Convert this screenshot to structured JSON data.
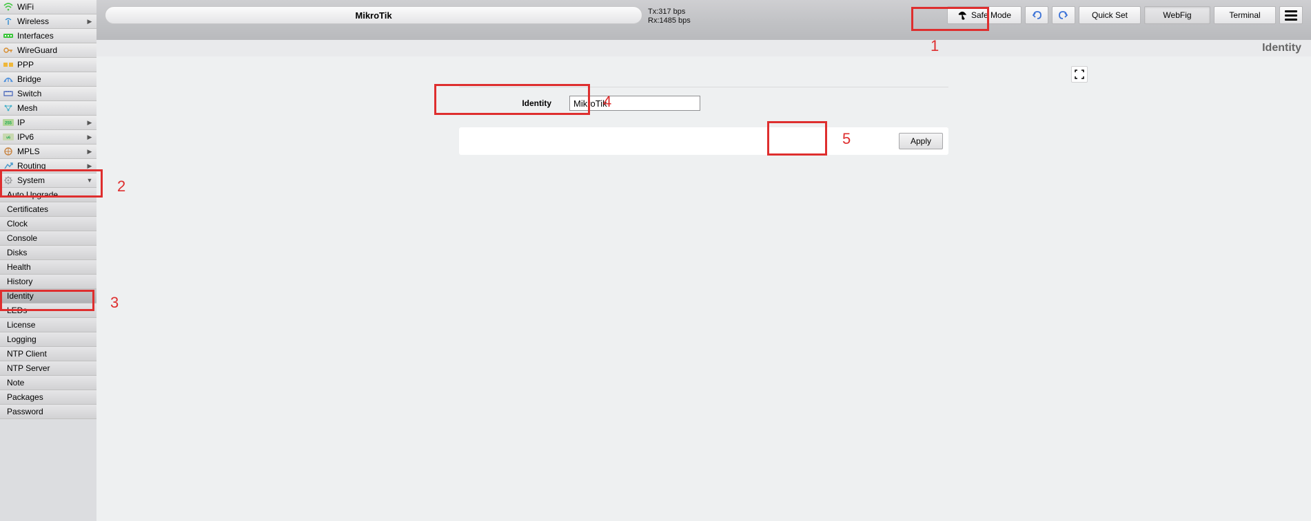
{
  "header": {
    "title": "MikroTik",
    "stats_tx": "Tx:317 bps",
    "stats_rx": "Rx:1485 bps",
    "safe_mode": "Safe Mode",
    "quick_set": "Quick Set",
    "webfig": "WebFig",
    "terminal": "Terminal"
  },
  "breadcrumb": "Identity",
  "sidebar": {
    "items": [
      {
        "label": "WiFi",
        "icon": "wifi-icon",
        "arrow": false
      },
      {
        "label": "Wireless",
        "icon": "antenna-icon",
        "arrow": true
      },
      {
        "label": "Interfaces",
        "icon": "ports-icon",
        "arrow": false
      },
      {
        "label": "WireGuard",
        "icon": "key-icon",
        "arrow": false
      },
      {
        "label": "PPP",
        "icon": "ppp-icon",
        "arrow": false
      },
      {
        "label": "Bridge",
        "icon": "bridge-icon",
        "arrow": false
      },
      {
        "label": "Switch",
        "icon": "switch-icon",
        "arrow": false
      },
      {
        "label": "Mesh",
        "icon": "mesh-icon",
        "arrow": false
      },
      {
        "label": "IP",
        "icon": "ip-icon",
        "arrow": true
      },
      {
        "label": "IPv6",
        "icon": "ipv6-icon",
        "arrow": true
      },
      {
        "label": "MPLS",
        "icon": "mpls-icon",
        "arrow": true
      },
      {
        "label": "Routing",
        "icon": "routing-icon",
        "arrow": true
      },
      {
        "label": "System",
        "icon": "gear-icon",
        "arrow": true,
        "expanded": true
      }
    ],
    "system_sub": [
      {
        "label": "Auto Upgrade"
      },
      {
        "label": "Certificates"
      },
      {
        "label": "Clock"
      },
      {
        "label": "Console"
      },
      {
        "label": "Disks"
      },
      {
        "label": "Health"
      },
      {
        "label": "History"
      },
      {
        "label": "Identity",
        "selected": true
      },
      {
        "label": "LEDs"
      },
      {
        "label": "License"
      },
      {
        "label": "Logging"
      },
      {
        "label": "NTP Client"
      },
      {
        "label": "NTP Server"
      },
      {
        "label": "Note"
      },
      {
        "label": "Packages"
      },
      {
        "label": "Password"
      }
    ]
  },
  "form": {
    "identity_label": "Identity",
    "identity_value": "MikroTik",
    "apply_label": "Apply"
  },
  "annotations": {
    "n1": "1",
    "n2": "2",
    "n3": "3",
    "n4": "4",
    "n5": "5"
  }
}
